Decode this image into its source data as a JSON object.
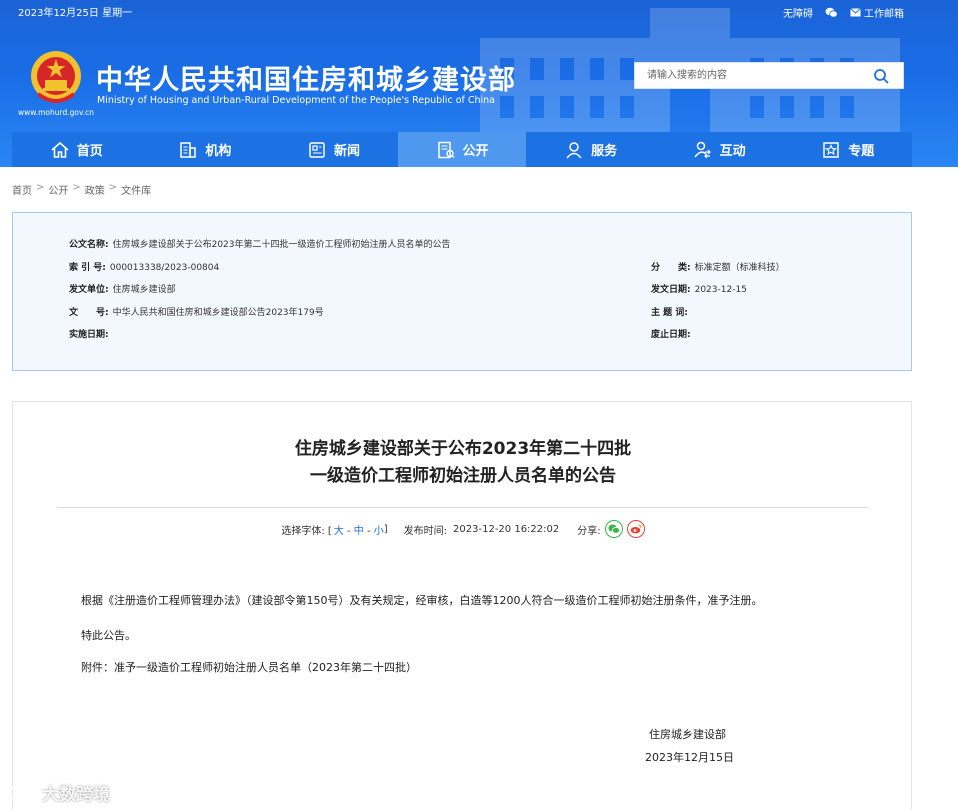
{
  "topbar": {
    "date": "2023年12月25日 星期一",
    "accessibility": "无障碍",
    "work_mail": "工作邮箱"
  },
  "site": {
    "title_cn": "中华人民共和国住房和城乡建设部",
    "title_en": "Ministry of Housing and Urban-Rural Development of the People's Republic of China",
    "url": "www.mohurd.gov.cn"
  },
  "search": {
    "placeholder": "请输入搜索的内容"
  },
  "nav": [
    {
      "label": "首页",
      "icon": "home-icon"
    },
    {
      "label": "机构",
      "icon": "building-icon"
    },
    {
      "label": "新闻",
      "icon": "news-icon"
    },
    {
      "label": "公开",
      "icon": "disclosure-icon",
      "active": true
    },
    {
      "label": "服务",
      "icon": "service-icon"
    },
    {
      "label": "互动",
      "icon": "interaction-icon"
    },
    {
      "label": "专题",
      "icon": "topic-icon"
    }
  ],
  "breadcrumb": [
    "首页",
    "公开",
    "政策",
    "文件库"
  ],
  "info": {
    "doc_name_label": "公文名称:",
    "doc_name": "住房城乡建设部关于公布2023年第二十四批一级造价工程师初始注册人员名单的公告",
    "index_label": "索 引 号:",
    "index": "000013338/2023-00804",
    "category_label": "分　　类:",
    "category": "标准定额（标准科技）",
    "issuer_label": "发文单位:",
    "issuer": "住房城乡建设部",
    "issue_date_label": "发文日期:",
    "issue_date": "2023-12-15",
    "doc_no_label": "文　　号:",
    "doc_no": "中华人民共和国住房和城乡建设部公告2023年179号",
    "subject_label": "主 题 词:",
    "subject": "",
    "effective_label": "实施日期:",
    "effective": "",
    "repeal_label": "废止日期:",
    "repeal": ""
  },
  "article": {
    "title_line1": "住房城乡建设部关于公布2023年第二十四批",
    "title_line2": "一级造价工程师初始注册人员名单的公告",
    "font_label": "选择字体: [",
    "font_large": "大",
    "font_medium": "中",
    "font_small": "小",
    "font_close": "]",
    "pub_label": "发布时间:",
    "pub_time": "2023-12-20 16:22:02",
    "share_label": "分享:",
    "para1": "根据《注册造价工程师管理办法》（建设部令第150号）及有关规定，经审核，白造等1200人符合一级造价工程师初始注册条件，准予注册。",
    "para2": "特此公告。",
    "para3": "附件：准予一级造价工程师初始注册人员名单（2023年第二十四批）",
    "sign_org": "住房城乡建设部",
    "sign_date": "2023年12月15日"
  },
  "watermark": "大数跨境",
  "colors": {
    "primary": "#1c71e3",
    "nav_active": "#4f98ef",
    "info_bg": "#f3f8fe",
    "info_border": "#a8c9ee"
  }
}
